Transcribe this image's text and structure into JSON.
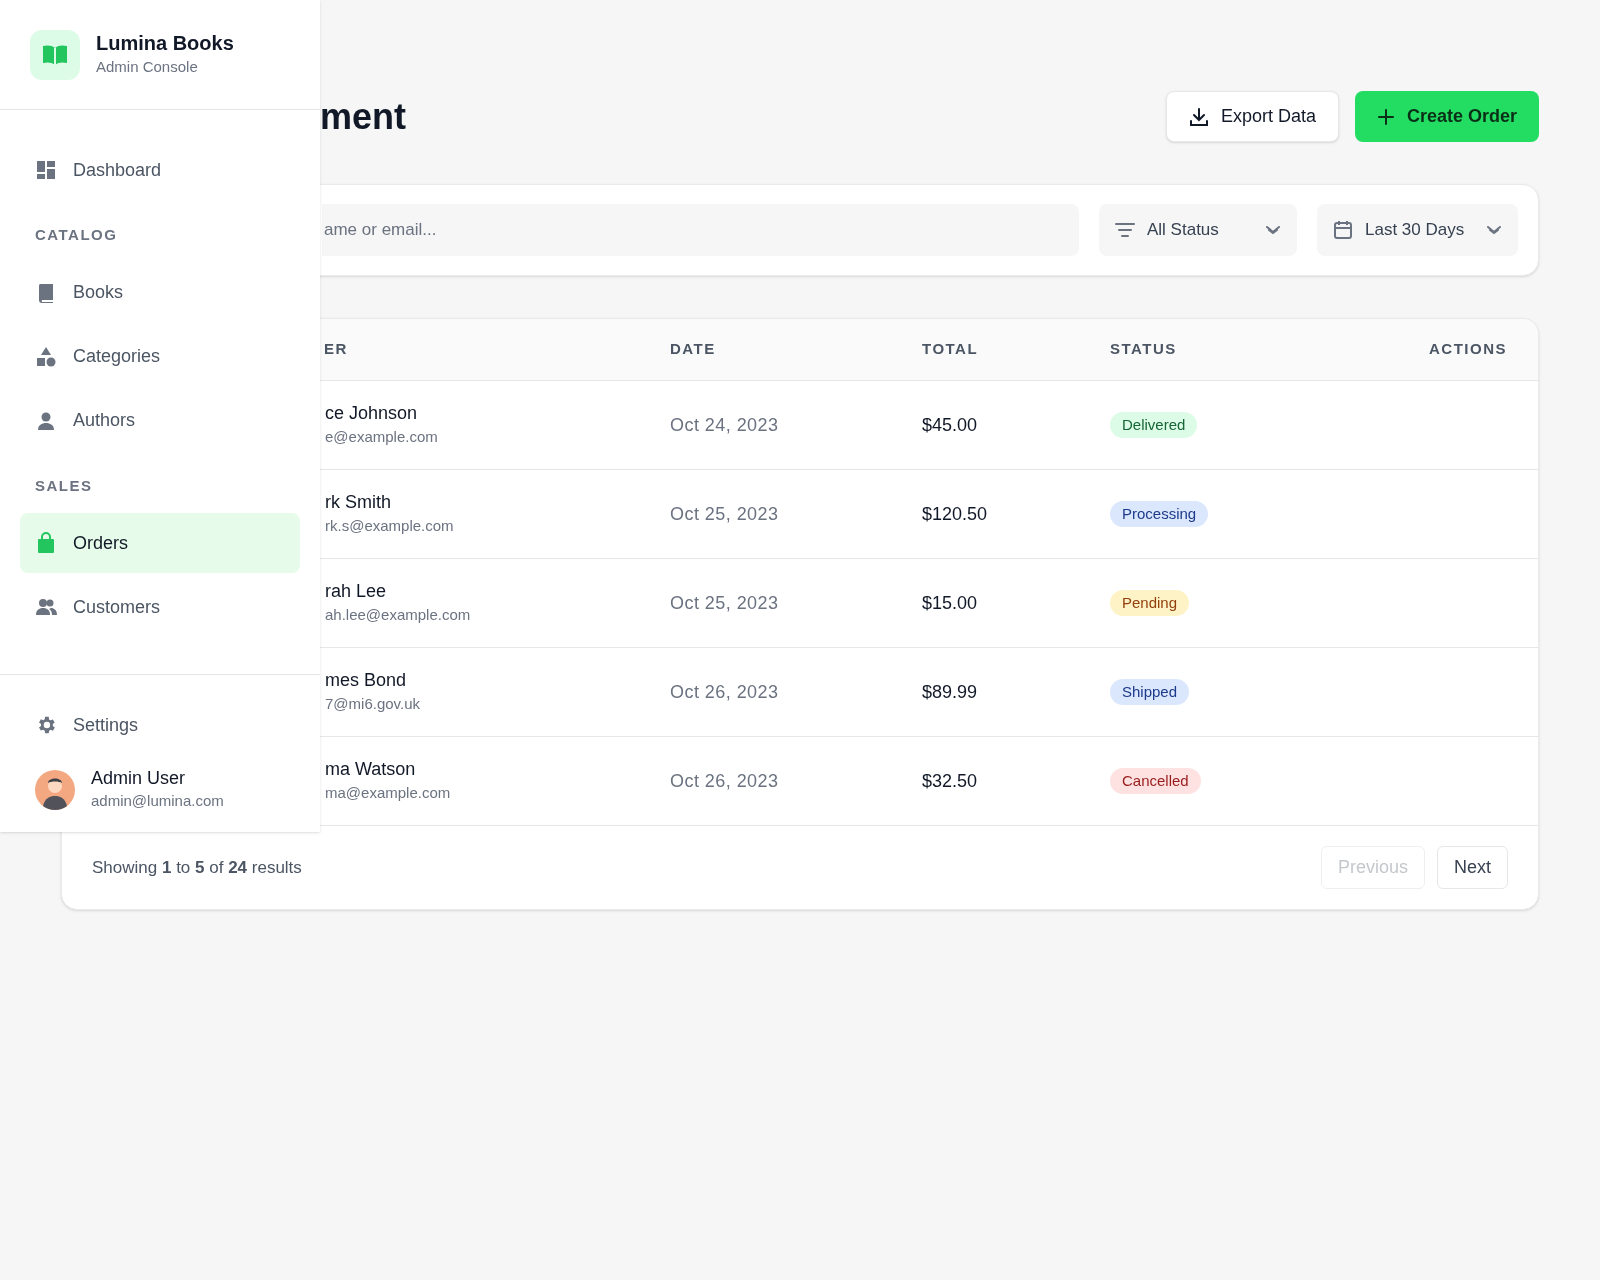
{
  "sidebar": {
    "brand": {
      "name": "Lumina Books",
      "subtitle": "Admin Console"
    },
    "items": [
      {
        "kind": "link",
        "label": "Dashboard",
        "selected": false
      },
      {
        "kind": "section",
        "label": "CATALOG"
      },
      {
        "kind": "link",
        "label": "Books",
        "selected": false
      },
      {
        "kind": "link",
        "label": "Categories",
        "selected": false
      },
      {
        "kind": "link",
        "label": "Authors",
        "selected": false
      },
      {
        "kind": "section",
        "label": "SALES"
      },
      {
        "kind": "link",
        "label": "Orders",
        "selected": true
      },
      {
        "kind": "link",
        "label": "Customers",
        "selected": false
      }
    ],
    "settings": {
      "label": "Settings"
    },
    "user": {
      "name": "Admin User",
      "email": "admin@lumina.com"
    }
  },
  "header": {
    "title": "ment",
    "buttons": [
      {
        "kind": "secondary",
        "label": "Export Data"
      },
      {
        "kind": "primary",
        "label": "Create Order"
      }
    ]
  },
  "filters": {
    "search": {
      "placeholder": "ame or email..."
    },
    "status": {
      "value": "All Status"
    },
    "range": {
      "value": "Last 30 Days"
    }
  },
  "table": {
    "columns": [
      "ER",
      "DATE",
      "TOTAL",
      "STATUS",
      "ACTIONS"
    ],
    "rows": [
      {
        "name": "ce Johnson",
        "email": "e@example.com",
        "date": "Oct 24, 2023",
        "total": "$45.00",
        "status": {
          "label": "Delivered",
          "kind": "success"
        }
      },
      {
        "name": "rk Smith",
        "email": "rk.s@example.com",
        "date": "Oct 25, 2023",
        "total": "$120.50",
        "status": {
          "label": "Processing",
          "kind": "info"
        }
      },
      {
        "name": "rah Lee",
        "email": "ah.lee@example.com",
        "date": "Oct 25, 2023",
        "total": "$15.00",
        "status": {
          "label": "Pending",
          "kind": "warning"
        }
      },
      {
        "name": "mes Bond",
        "email": "7@mi6.gov.uk",
        "date": "Oct 26, 2023",
        "total": "$89.99",
        "status": {
          "label": "Shipped",
          "kind": "info"
        }
      },
      {
        "name": "ma Watson",
        "email": "ma@example.com",
        "date": "Oct 26, 2023",
        "total": "$32.50",
        "status": {
          "label": "Cancelled",
          "kind": "danger"
        }
      }
    ]
  },
  "pagination": {
    "summary": "Showing **1** to **5** of **24** results",
    "previous": {
      "label": "Previous",
      "disabled": true
    },
    "next": {
      "label": "Next",
      "disabled": false
    }
  }
}
